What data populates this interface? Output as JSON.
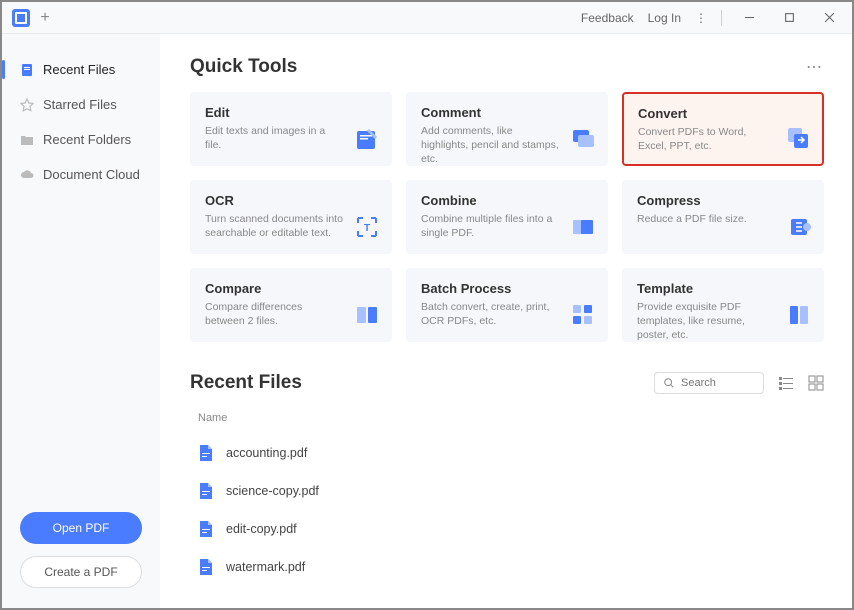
{
  "titlebar": {
    "feedback": "Feedback",
    "login": "Log In"
  },
  "sidebar": {
    "items": [
      {
        "label": "Recent Files"
      },
      {
        "label": "Starred Files"
      },
      {
        "label": "Recent Folders"
      },
      {
        "label": "Document Cloud"
      }
    ],
    "open_btn": "Open PDF",
    "create_btn": "Create a PDF"
  },
  "quick_tools": {
    "title": "Quick Tools",
    "cards": [
      {
        "title": "Edit",
        "desc": "Edit texts and images in a file."
      },
      {
        "title": "Comment",
        "desc": "Add comments, like highlights, pencil and stamps, etc."
      },
      {
        "title": "Convert",
        "desc": "Convert PDFs to Word, Excel, PPT, etc."
      },
      {
        "title": "OCR",
        "desc": "Turn scanned documents into searchable or editable text."
      },
      {
        "title": "Combine",
        "desc": "Combine multiple files into a single PDF."
      },
      {
        "title": "Compress",
        "desc": "Reduce a PDF file size."
      },
      {
        "title": "Compare",
        "desc": "Compare differences between 2 files."
      },
      {
        "title": "Batch Process",
        "desc": "Batch convert, create, print, OCR PDFs, etc."
      },
      {
        "title": "Template",
        "desc": "Provide exquisite PDF templates, like resume, poster, etc."
      }
    ]
  },
  "recent": {
    "title": "Recent Files",
    "search_placeholder": "Search",
    "name_col": "Name",
    "files": [
      {
        "name": "accounting.pdf"
      },
      {
        "name": "science-copy.pdf"
      },
      {
        "name": "edit-copy.pdf"
      },
      {
        "name": "watermark.pdf"
      }
    ]
  }
}
